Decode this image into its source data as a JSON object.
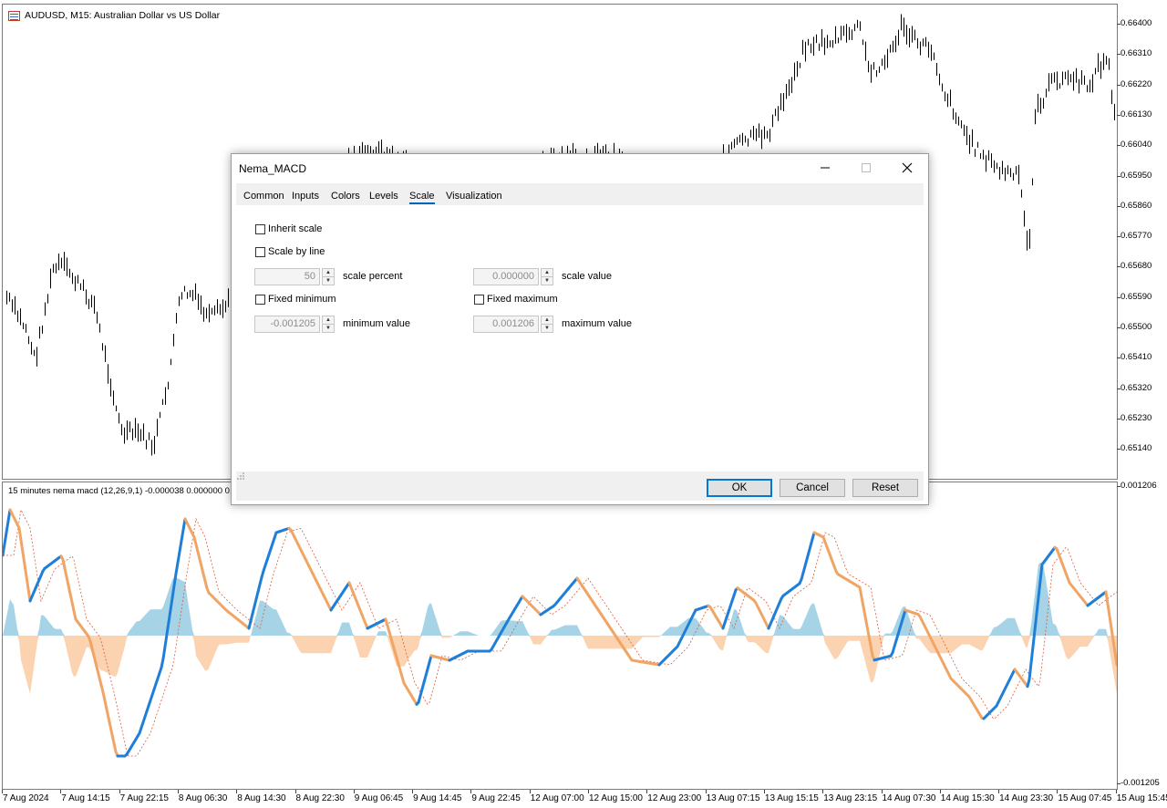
{
  "chart": {
    "symbol_title": "AUDUSD, M15:  Australian Dollar vs US Dollar",
    "price_axis": [
      "0.66400",
      "0.66310",
      "0.66220",
      "0.66130",
      "0.66040",
      "0.65950",
      "0.65860",
      "0.65770",
      "0.65680",
      "0.65590",
      "0.65500",
      "0.65410",
      "0.65320",
      "0.65230",
      "0.65140"
    ],
    "indicator_title": "15 minutes nema macd (12,26,9,1) -0.000038 0.000000 0.000000",
    "macd_axis_top": "0.001206",
    "macd_axis_bottom": "-0.001205",
    "time_axis": [
      "7 Aug 2024",
      "7 Aug 14:15",
      "7 Aug 22:15",
      "8 Aug 06:30",
      "8 Aug 14:30",
      "8 Aug 22:30",
      "9 Aug 06:45",
      "9 Aug 14:45",
      "9 Aug 22:45",
      "12 Aug 07:00",
      "12 Aug 15:00",
      "12 Aug 23:00",
      "13 Aug 07:15",
      "13 Aug 15:15",
      "13 Aug 23:15",
      "14 Aug 07:30",
      "14 Aug 15:30",
      "14 Aug 23:30",
      "15 Aug 07:45",
      "15 Aug 15:45"
    ]
  },
  "colors": {
    "macd_line_up": "#1f7fd8",
    "macd_line_down": "#f0a565",
    "signal_line": "#e05a3a",
    "hist_positive": "#a6d4e6",
    "hist_negative": "#fcd3b0",
    "dialog_primary": "#0078d7"
  },
  "dialog": {
    "title": "Nema_MACD",
    "tabs": [
      "Common",
      "Inputs",
      "Colors",
      "Levels",
      "Scale",
      "Visualization"
    ],
    "active_tab": "Scale",
    "inherit_scale": "Inherit scale",
    "scale_by_line": "Scale by line",
    "scale_percent_value": "50",
    "scale_percent_label": "scale percent",
    "scale_value_value": "0.000000",
    "scale_value_label": "scale value",
    "fixed_minimum": "Fixed minimum",
    "fixed_maximum": "Fixed maximum",
    "minimum_value_value": "-0.001205",
    "minimum_value_label": "minimum value",
    "maximum_value_value": "0.001206",
    "maximum_value_label": "maximum value",
    "ok": "OK",
    "cancel": "Cancel",
    "reset": "Reset"
  }
}
